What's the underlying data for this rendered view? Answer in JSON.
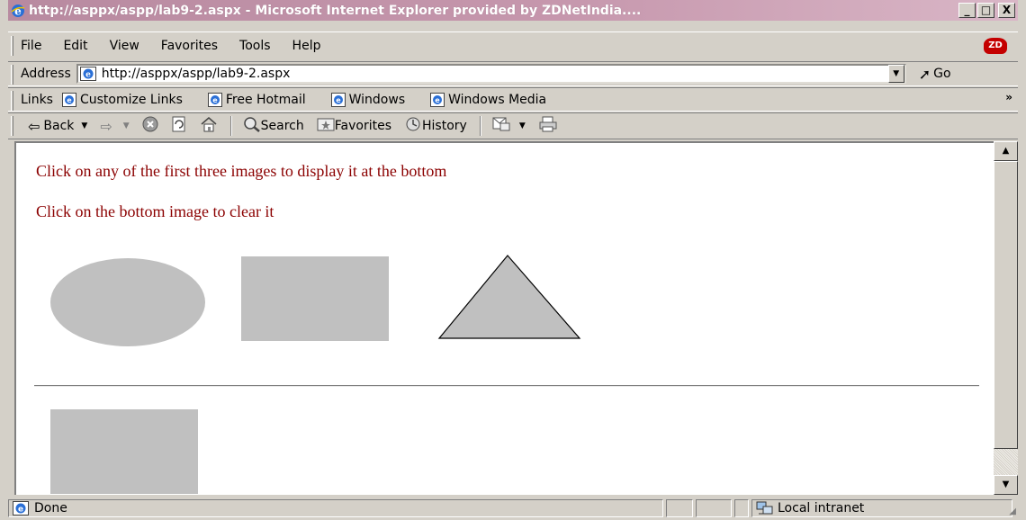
{
  "window": {
    "title": "http://asppx/aspp/lab9-2.aspx - Microsoft Internet Explorer provided by ZDNetIndia....",
    "buttons": {
      "minimize": "_",
      "maximize": "□",
      "close": "X"
    }
  },
  "menu": {
    "items": [
      "File",
      "Edit",
      "View",
      "Favorites",
      "Tools",
      "Help"
    ],
    "logo": "ZD"
  },
  "address": {
    "label": "Address",
    "value": "http://asppx/aspp/lab9-2.aspx",
    "go_label": "Go"
  },
  "links": {
    "label": "Links",
    "items": [
      "Customize Links",
      "Free Hotmail",
      "Windows",
      "Windows Media"
    ],
    "more": "»"
  },
  "toolbar": {
    "back_label": "Back",
    "search_label": "Search",
    "favorites_label": "Favorites",
    "history_label": "History"
  },
  "page": {
    "instruction_1": "Click on any of the first three images to display it at the bottom",
    "instruction_2": "Click on the bottom image to clear it",
    "shape_color": "#c0c0c0",
    "text_color": "#8b0000"
  },
  "status": {
    "text": "Done",
    "zone": "Local intranet"
  }
}
